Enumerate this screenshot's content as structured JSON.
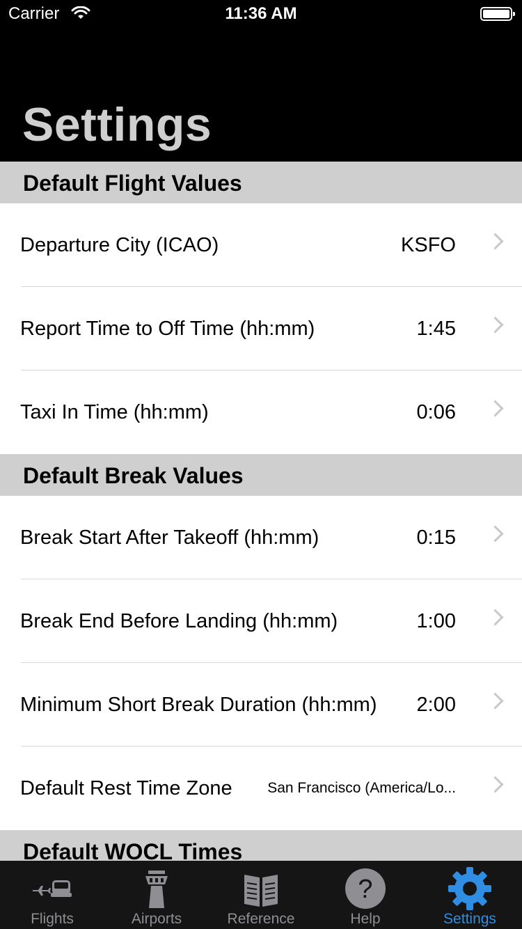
{
  "status_bar": {
    "carrier": "Carrier",
    "time": "11:36 AM"
  },
  "page_title": "Settings",
  "sections": [
    {
      "header": "Default Flight Values",
      "rows": [
        {
          "label": "Departure City (ICAO)",
          "value": "KSFO"
        },
        {
          "label": "Report Time to Off Time (hh:mm)",
          "value": "1:45"
        },
        {
          "label": "Taxi In Time (hh:mm)",
          "value": "0:06"
        }
      ]
    },
    {
      "header": "Default Break Values",
      "rows": [
        {
          "label": "Break Start After Takeoff (hh:mm)",
          "value": "0:15"
        },
        {
          "label": "Break End Before Landing (hh:mm)",
          "value": "1:00"
        },
        {
          "label": "Minimum Short Break Duration (hh:mm)",
          "value": "2:00"
        },
        {
          "label": "Default Rest Time Zone",
          "value": "San Francisco (America/Lo..."
        }
      ]
    },
    {
      "header": "Default WOCL Times"
    }
  ],
  "tabs": [
    {
      "label": "Flights",
      "icon": "flights-icon",
      "active": false
    },
    {
      "label": "Airports",
      "icon": "airport-tower-icon",
      "active": false
    },
    {
      "label": "Reference",
      "icon": "book-icon",
      "active": false
    },
    {
      "label": "Help",
      "icon": "question-mark-icon",
      "active": false
    },
    {
      "label": "Settings",
      "icon": "gear-icon",
      "active": true
    }
  ],
  "colors": {
    "accent": "#2f8de4",
    "inactive_tab": "#8e8e93",
    "section_header_bg": "#cfcfcf",
    "tab_bar_bg": "#151515"
  }
}
